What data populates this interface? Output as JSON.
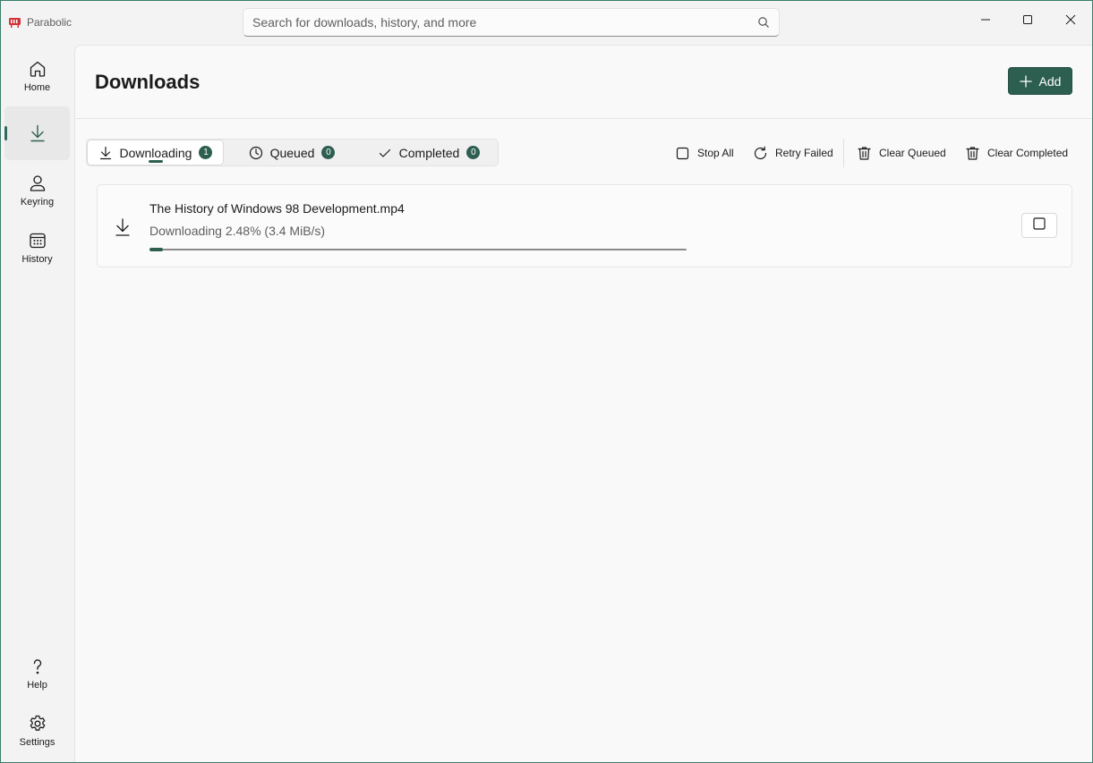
{
  "app": {
    "title": "Parabolic",
    "accent_color": "#2d5f51",
    "logo_color": "#d13438"
  },
  "search": {
    "placeholder": "Search for downloads, history, and more",
    "value": ""
  },
  "window_controls": [
    "minimize-icon",
    "maximize-icon",
    "close-icon"
  ],
  "sidebar": {
    "items": [
      {
        "label": "Home",
        "icon": "home-icon",
        "active": false
      },
      {
        "label": "",
        "icon": "download-icon",
        "active": true
      },
      {
        "label": "Keyring",
        "icon": "person-icon",
        "active": false
      },
      {
        "label": "History",
        "icon": "calendar-icon",
        "active": false
      }
    ],
    "footer_items": [
      {
        "label": "Help",
        "icon": "question-icon"
      },
      {
        "label": "Settings",
        "icon": "gear-icon"
      }
    ]
  },
  "page": {
    "title": "Downloads",
    "add_label": "Add"
  },
  "tabs": [
    {
      "label": "Downloading",
      "count": "1",
      "icon": "download-icon",
      "active": true
    },
    {
      "label": "Queued",
      "count": "0",
      "icon": "clock-icon",
      "active": false
    },
    {
      "label": "Completed",
      "count": "0",
      "icon": "checkmark-icon",
      "active": false
    }
  ],
  "toolbar": {
    "stop_all": "Stop All",
    "retry_failed": "Retry Failed",
    "clear_queued": "Clear Queued",
    "clear_completed": "Clear Completed"
  },
  "downloads": [
    {
      "name": "The History of Windows 98 Development.mp4",
      "status": "Downloading 2.48% (3.4 MiB/s)",
      "progress": 0.0248
    }
  ]
}
